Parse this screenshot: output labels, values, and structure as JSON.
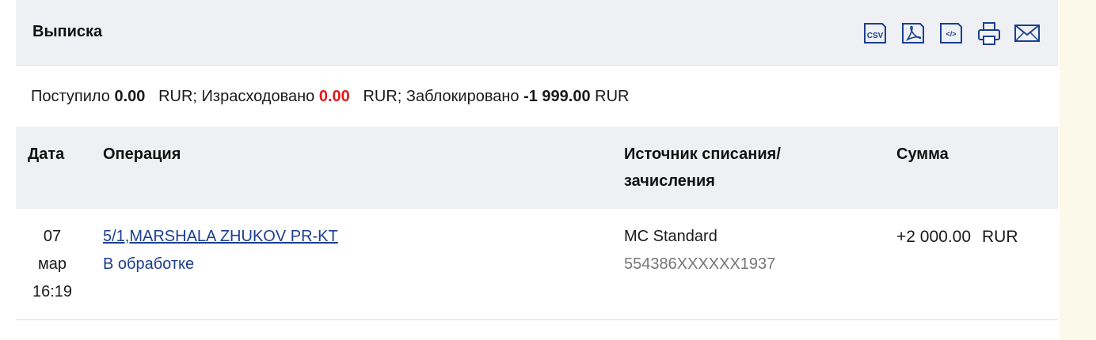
{
  "header": {
    "title": "Выписка",
    "actions": [
      {
        "name": "csv-export-button",
        "icon": "csv-icon",
        "label": "csv"
      },
      {
        "name": "pdf-export-button",
        "icon": "pdf-icon"
      },
      {
        "name": "xml-export-button",
        "icon": "xml-icon",
        "label": "</>"
      },
      {
        "name": "print-button",
        "icon": "printer-icon"
      },
      {
        "name": "email-button",
        "icon": "envelope-icon"
      }
    ],
    "icon_color": "#1b3f8f"
  },
  "summary": {
    "income_label": "Поступило",
    "income_value": "0.00",
    "income_currency": "RUR;",
    "spent_label": "Израсходовано",
    "spent_value": "0.00",
    "spent_currency": "RUR;",
    "blocked_label": "Заблокировано",
    "blocked_value": "-1 999.00",
    "blocked_currency": "RUR",
    "spent_color": "#e01b1b"
  },
  "table": {
    "columns": {
      "date": "Дата",
      "operation": "Операция",
      "source": "Источник списания/ зачисления",
      "amount": "Сумма"
    },
    "rows": [
      {
        "day": "07",
        "month": "мар",
        "time": "16:19",
        "operation": "5/1,MARSHALA ZHUKOV PR-KT",
        "status": "В обработке",
        "source_name": "MC Standard",
        "source_card": "554386XXXXXX1937",
        "amount": "+2 000.00",
        "currency": "RUR"
      }
    ]
  }
}
